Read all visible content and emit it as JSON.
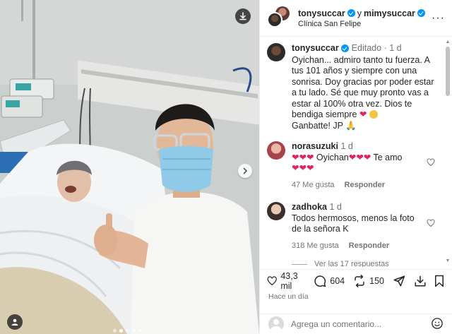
{
  "post": {
    "image_alt": "",
    "carousel": {
      "count": 5,
      "active_index": 1
    }
  },
  "header": {
    "user1": "tonysuccar",
    "conjunction": "y",
    "user2": "mimysuccar",
    "location": "Clínica San Felipe",
    "more_icon": "more-horizontal-icon"
  },
  "caption": {
    "username": "tonysuccar",
    "edited": "Editado",
    "separator": "·",
    "time": "1 d",
    "text_line1": "Oyichan... admiro tanto tu fuerza. A tus 101 años y siempre con una sonrisa. Doy gracias por poder estar a tu lado. Sé que muy pronto vas a estar al 100% otra vez. Dios te bendiga siempre",
    "text_line2": "Ganbatte! JP"
  },
  "comments": [
    {
      "username": "norasuzuki",
      "time": "1 d",
      "text": "Oyichan",
      "text_suffix": "Te amo",
      "likes": "47 Me gusta",
      "reply": "Responder"
    },
    {
      "username": "zadhoka",
      "time": "1 d",
      "text": "Todos hermosos, menos la foto de la señora K",
      "likes": "318 Me gusta",
      "reply": "Responder",
      "view_replies": "Ver las 17 respuestas"
    }
  ],
  "actions": {
    "likes": "43,3 mil",
    "comments": "604",
    "shares": "150"
  },
  "time_ago": "Hace un día",
  "add_comment": {
    "placeholder": "Agrega un comentario..."
  },
  "colors": {
    "verified": "#0095f6",
    "heart": "#e0245e",
    "muted": "#737373"
  }
}
